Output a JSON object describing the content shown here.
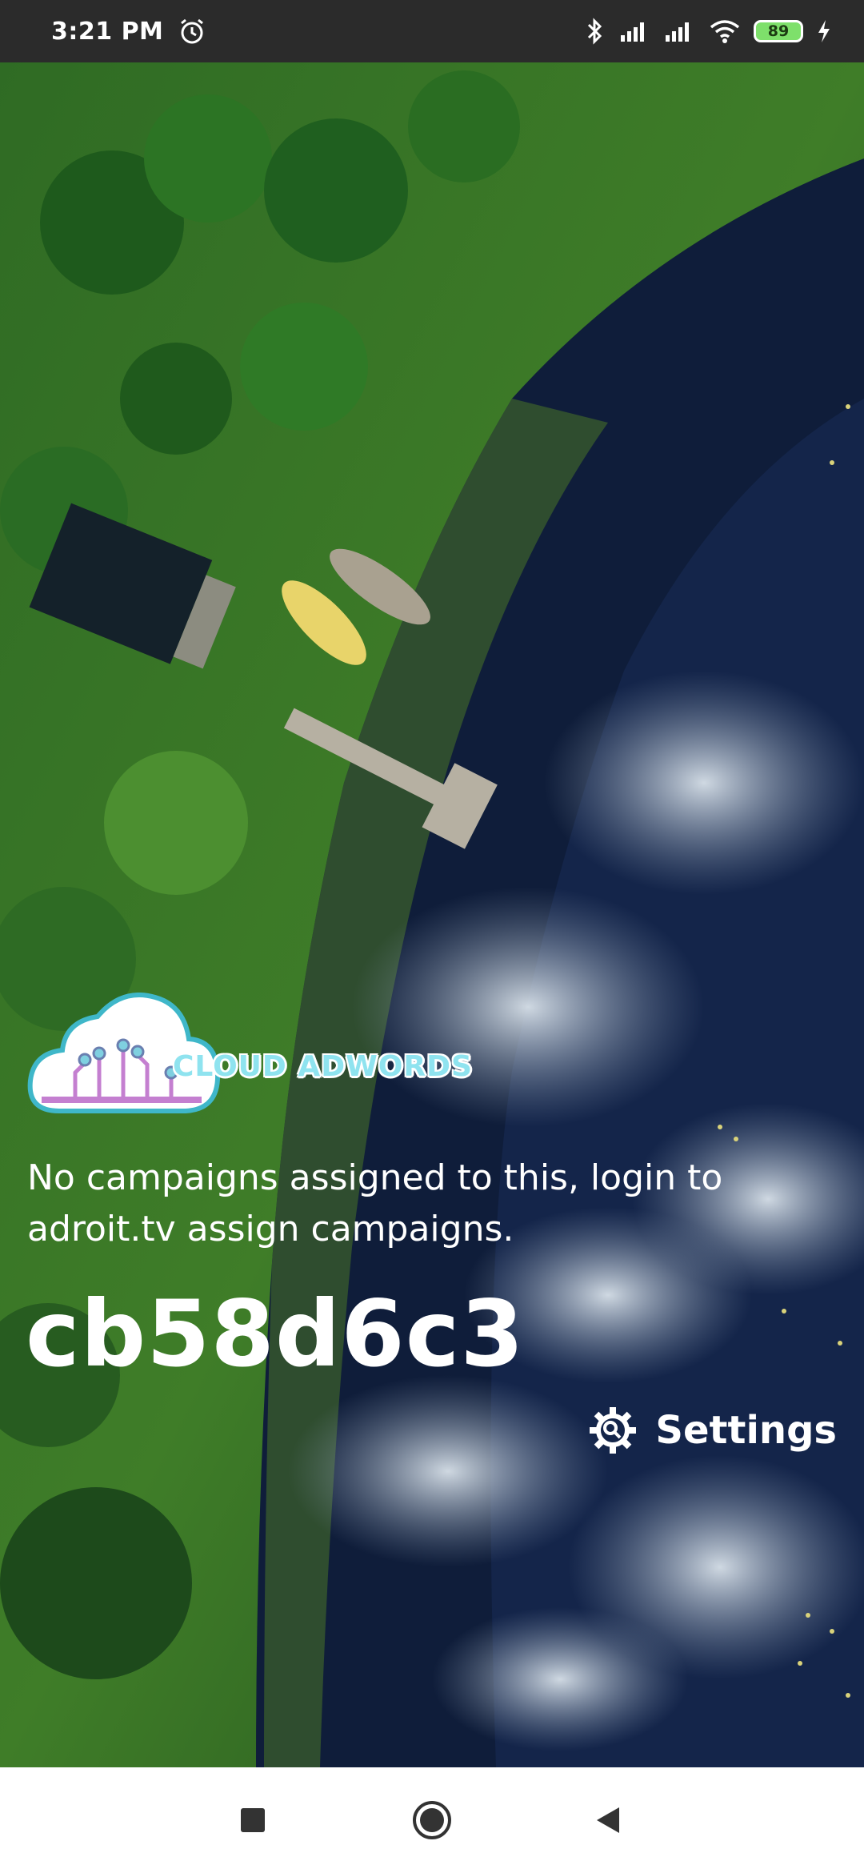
{
  "status_bar": {
    "time": "3:21 PM",
    "battery_level": "89",
    "icons": [
      "alarm-icon",
      "bluetooth-icon",
      "signal-icon",
      "signal-icon",
      "wifi-icon",
      "battery-icon",
      "charging-icon"
    ]
  },
  "logo": {
    "text": "CLOUD ADWORDS",
    "icon": "cloud-circuit-logo"
  },
  "main": {
    "message": "No campaigns assigned to this, login to adroit.tv assign campaigns.",
    "device_code": "cb58d6c3",
    "settings_label": "Settings"
  },
  "nav_bar": {
    "buttons": [
      "recent-apps",
      "home",
      "back"
    ]
  },
  "colors": {
    "status_bar_bg": "#2b2b2b",
    "battery_fill": "#7ee06b",
    "logo_accent": "#8fe3ef",
    "nav_bg": "#ffffff"
  }
}
